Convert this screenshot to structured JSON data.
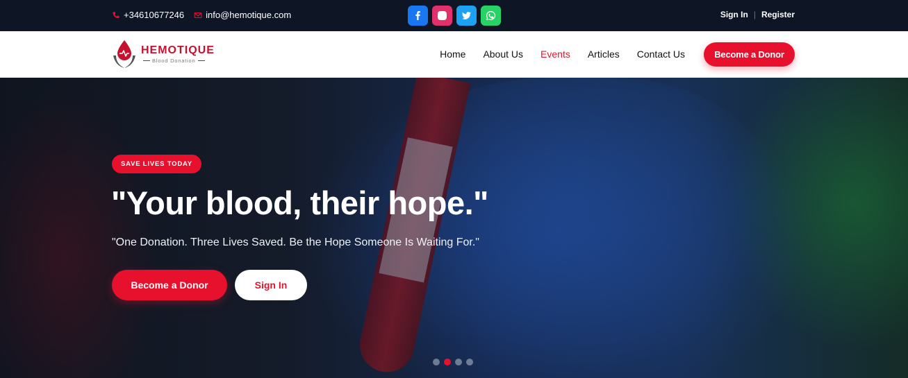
{
  "topbar": {
    "phone": "+34610677246",
    "email": "info@hemotique.com",
    "socials": [
      {
        "name": "facebook-icon",
        "color": "#1877f2"
      },
      {
        "name": "instagram-icon",
        "color": "#e1306c"
      },
      {
        "name": "twitter-icon",
        "color": "#1da1f2"
      },
      {
        "name": "whatsapp-icon",
        "color": "#25d366"
      }
    ],
    "sign_in": "Sign In",
    "separator": "|",
    "register": "Register"
  },
  "navbar": {
    "logo": {
      "brand": "HEMOTIQUE",
      "subtitle": "Blood Donation"
    },
    "menu": [
      {
        "label": "Home",
        "active": false
      },
      {
        "label": "About Us",
        "active": false
      },
      {
        "label": "Events",
        "active": true
      },
      {
        "label": "Articles",
        "active": false
      },
      {
        "label": "Contact Us",
        "active": false
      }
    ],
    "cta": "Become a Donor"
  },
  "hero": {
    "badge": "SAVE LIVES TODAY",
    "headline": "\"Your blood, their hope.\"",
    "tagline": "\"One Donation. Three Lives Saved. Be the Hope Someone Is Waiting For.\"",
    "primary_button": "Become a Donor",
    "secondary_button": "Sign In",
    "slides": {
      "count": 4,
      "active_index": 1
    }
  },
  "colors": {
    "accent": "#e8112d",
    "topbar_bg": "#0e1626"
  }
}
